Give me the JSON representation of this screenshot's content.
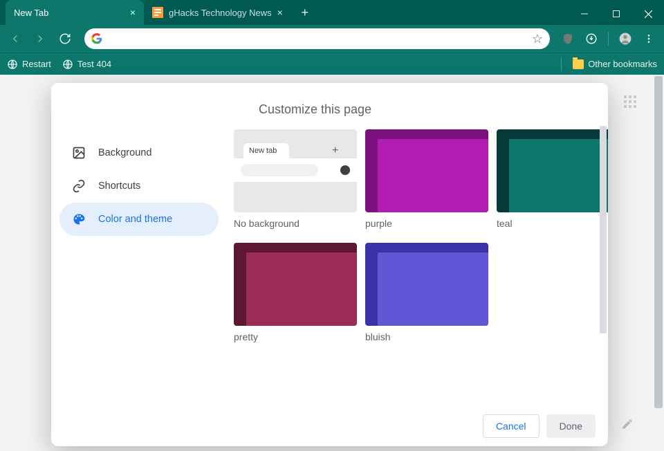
{
  "tabs": [
    {
      "title": "New Tab",
      "active": true
    },
    {
      "title": "gHacks Technology News",
      "active": false
    }
  ],
  "bookmarks": {
    "items": [
      {
        "label": "Restart"
      },
      {
        "label": "Test 404"
      }
    ],
    "other_label": "Other bookmarks"
  },
  "dialog": {
    "title": "Customize this page",
    "sidenav": {
      "background": "Background",
      "shortcuts": "Shortcuts",
      "color_theme": "Color and theme"
    },
    "themes": {
      "no_background": {
        "label": "No background",
        "tab_label": "New tab"
      },
      "purple": {
        "label": "purple",
        "c1": "#7a117c",
        "c2": "#b11db3",
        "c3": "#b11db3"
      },
      "teal": {
        "label": "teal",
        "c1": "#063a3a",
        "c2": "#0d776c",
        "c3": "#0d776c"
      },
      "pretty": {
        "label": "pretty",
        "c1": "#5e1733",
        "c2": "#9b2c57",
        "c3": "#9b2c57"
      },
      "bluish": {
        "label": "bluish",
        "c1": "#3a32a8",
        "c2": "#6157d6",
        "c3": "#6157d6"
      }
    },
    "cancel": "Cancel",
    "done": "Done"
  }
}
